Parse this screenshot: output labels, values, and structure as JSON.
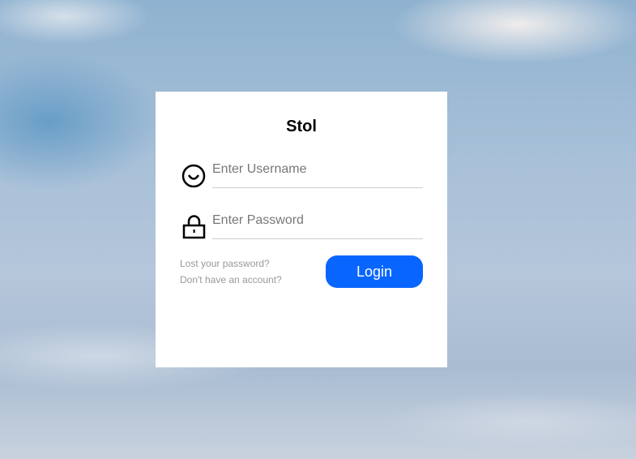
{
  "app": {
    "title": "Stol"
  },
  "form": {
    "username_placeholder": "Enter Username",
    "password_placeholder": "Enter Password",
    "lost_password": "Lost your password?",
    "no_account": "Don't have an account?",
    "login_label": "Login"
  },
  "colors": {
    "accent": "#0866ff"
  }
}
